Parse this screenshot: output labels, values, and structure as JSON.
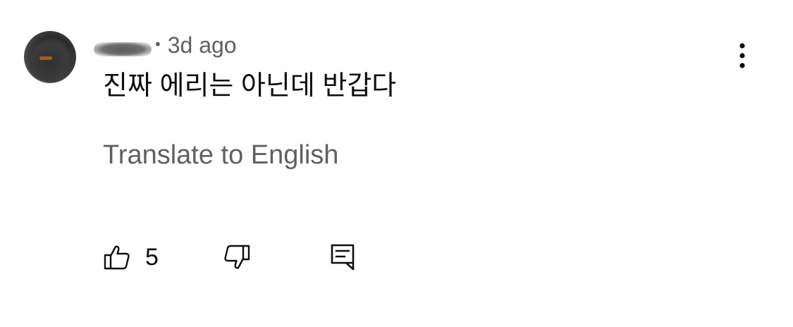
{
  "comment": {
    "author_redacted": true,
    "separator": "•",
    "timestamp": "3d ago",
    "text": "진짜 에리는 아닌데 반갑다",
    "translate_label": "Translate to English",
    "like_count": "5"
  },
  "icons": {
    "more": "more-vertical-icon",
    "like": "thumbs-up-icon",
    "dislike": "thumbs-down-icon",
    "reply": "reply-comment-icon"
  },
  "colors": {
    "primary_text": "#0f0f0f",
    "secondary_text": "#606060",
    "avatar_accent": "#d96a1c"
  }
}
